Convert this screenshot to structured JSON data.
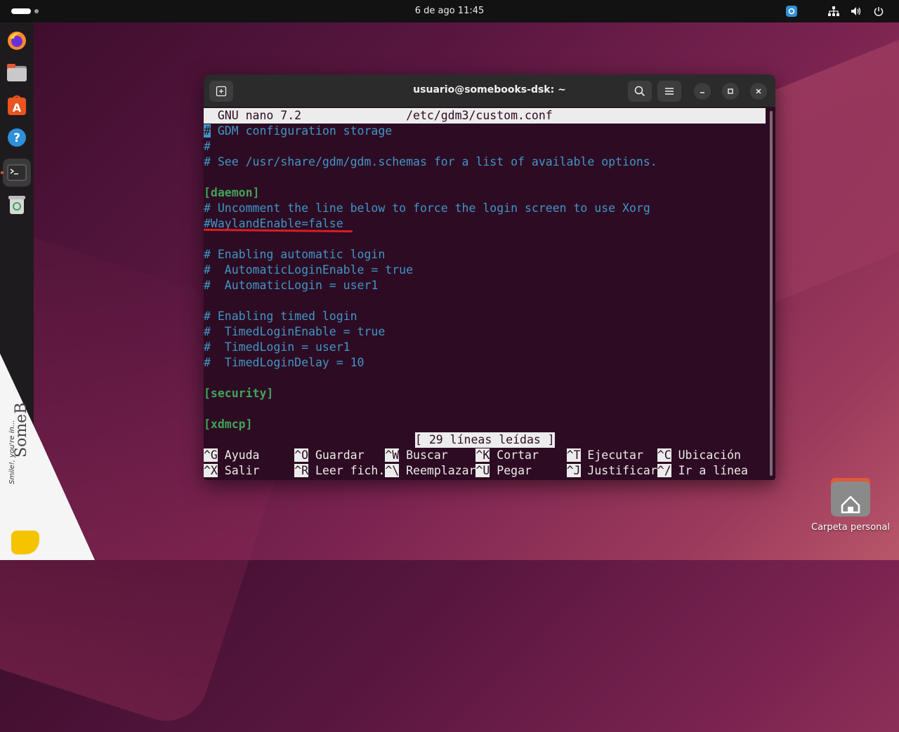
{
  "topbar": {
    "clock": "6 de ago  11:45"
  },
  "dock": {
    "items": [
      {
        "name": "firefox"
      },
      {
        "name": "files"
      },
      {
        "name": "app-center"
      },
      {
        "name": "help"
      },
      {
        "name": "terminal"
      },
      {
        "name": "trash"
      }
    ]
  },
  "desktop": {
    "home_label": "Carpeta personal"
  },
  "watermark": {
    "brand": "SomeB",
    "tagline": "Smile!, you're in..."
  },
  "window": {
    "title": "usuario@somebooks-dsk: ~",
    "header": "  GNU nano 7.2               /etc/gdm3/custom.conf",
    "lines": [
      {
        "text": "# GDM configuration storage",
        "style": "comment"
      },
      {
        "text": "#",
        "style": "comment"
      },
      {
        "text": "# See /usr/share/gdm/gdm.schemas for a list of available options.",
        "style": "comment"
      },
      {
        "text": "",
        "style": "comment"
      },
      {
        "text": "[daemon]",
        "style": "section"
      },
      {
        "text": "# Uncomment the line below to force the login screen to use Xorg",
        "style": "comment"
      },
      {
        "text": "#WaylandEnable=false",
        "style": "comment"
      },
      {
        "text": "",
        "style": "comment"
      },
      {
        "text": "# Enabling automatic login",
        "style": "comment"
      },
      {
        "text": "#  AutomaticLoginEnable = true",
        "style": "comment"
      },
      {
        "text": "#  AutomaticLogin = user1",
        "style": "comment"
      },
      {
        "text": "",
        "style": "comment"
      },
      {
        "text": "# Enabling timed login",
        "style": "comment"
      },
      {
        "text": "#  TimedLoginEnable = true",
        "style": "comment"
      },
      {
        "text": "#  TimedLogin = user1",
        "style": "comment"
      },
      {
        "text": "#  TimedLoginDelay = 10",
        "style": "comment"
      },
      {
        "text": "",
        "style": "comment"
      },
      {
        "text": "[security]",
        "style": "section"
      },
      {
        "text": "",
        "style": "comment"
      },
      {
        "text": "[xdmcp]",
        "style": "section"
      }
    ],
    "status": "[ 29 líneas leídas ]",
    "shortcuts_row1": [
      {
        "key": "^G",
        "label": " Ayuda     "
      },
      {
        "key": "^O",
        "label": " Guardar   "
      },
      {
        "key": "^W",
        "label": " Buscar    "
      },
      {
        "key": "^K",
        "label": " Cortar    "
      },
      {
        "key": "^T",
        "label": " Ejecutar  "
      },
      {
        "key": "^C",
        "label": " Ubicación"
      }
    ],
    "shortcuts_row2": [
      {
        "key": "^X",
        "label": " Salir     "
      },
      {
        "key": "^R",
        "label": " Leer fich."
      },
      {
        "key": "^\\",
        "label": " Reemplazar"
      },
      {
        "key": "^U",
        "label": " Pegar     "
      },
      {
        "key": "^J",
        "label": " Justificar"
      },
      {
        "key": "^/",
        "label": " Ir a línea"
      }
    ]
  }
}
